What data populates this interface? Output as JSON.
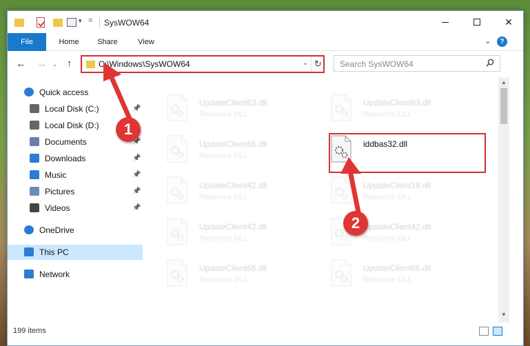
{
  "window": {
    "title": "SysWOW64",
    "min_label": "",
    "max_label": "",
    "close_label": "✕"
  },
  "ribbon": {
    "tabs": [
      {
        "label": "File"
      },
      {
        "label": "Home"
      },
      {
        "label": "Share"
      },
      {
        "label": "View"
      }
    ],
    "chevron": "⌄",
    "help": "?"
  },
  "address": {
    "path": "C:\\Windows\\SysWOW64",
    "search_placeholder": "Search SysWOW64"
  },
  "nav": {
    "back": "←",
    "forward": "→",
    "caret": "⌄",
    "up": "↑",
    "items": [
      {
        "label": "Quick access",
        "icon": "star-icon",
        "pinned": false
      },
      {
        "label": "Local Disk (C:)",
        "icon": "drive-icon",
        "pinned": true
      },
      {
        "label": "Local Disk (D:)",
        "icon": "drive-icon",
        "pinned": false
      },
      {
        "label": "Documents",
        "icon": "documents-icon",
        "pinned": true
      },
      {
        "label": "Downloads",
        "icon": "download-icon",
        "pinned": true
      },
      {
        "label": "Music",
        "icon": "music-icon",
        "pinned": true
      },
      {
        "label": "Pictures",
        "icon": "pictures-icon",
        "pinned": true
      },
      {
        "label": "Videos",
        "icon": "videos-icon",
        "pinned": true
      },
      {
        "label": "OneDrive",
        "icon": "cloud-icon",
        "pinned": false
      },
      {
        "label": "This PC",
        "icon": "computer-icon",
        "pinned": false,
        "selected": true
      },
      {
        "label": "Network",
        "icon": "network-icon",
        "pinned": false
      }
    ]
  },
  "files": [
    {
      "name": "UpdateClient63.dll",
      "type": "Resource DLL",
      "faded": true
    },
    {
      "name": "UpdateClient63.dll",
      "type": "Resource DLL",
      "faded": true
    },
    {
      "name": "UpdateClient65.dll",
      "type": "Resource DLL",
      "faded": true
    },
    {
      "name": "iddbas32.dll",
      "type": "",
      "faded": false
    },
    {
      "name": "UpdateClient42.dll",
      "type": "Resource DLL",
      "faded": true
    },
    {
      "name": "UpdateClient19.dll",
      "type": "Resource DLL",
      "faded": true
    },
    {
      "name": "UpdateClient42.dll",
      "type": "Resource DLL",
      "faded": true
    },
    {
      "name": "UpdateClient42.dll",
      "type": "Resource DLL",
      "faded": true
    },
    {
      "name": "UpdateClient65.dll",
      "type": "Resource DLL",
      "faded": true
    },
    {
      "name": "UpdateClient65.dll",
      "type": "Resource DLL",
      "faded": true
    }
  ],
  "status": {
    "count": "199 items"
  },
  "annotations": [
    {
      "label": "1"
    },
    {
      "label": "2"
    }
  ],
  "colors": {
    "accent": "#1979ca",
    "highlight": "#d03030",
    "marker": "#e03535",
    "selection": "#cce8ff"
  }
}
